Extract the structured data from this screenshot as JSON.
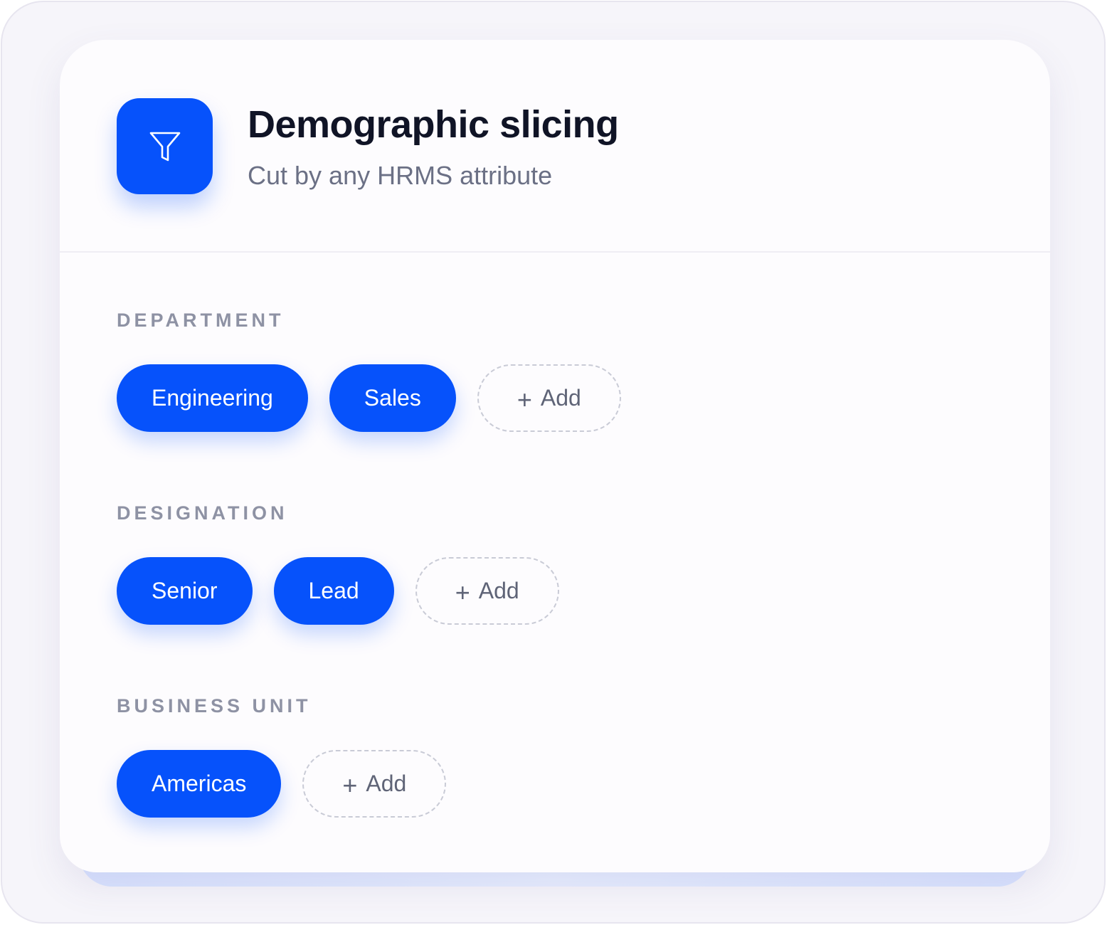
{
  "header": {
    "icon": "filter-funnel-icon",
    "title": "Demographic slicing",
    "subtitle": "Cut by any HRMS attribute"
  },
  "colors": {
    "accent": "#0652fb",
    "label_gray": "#8e92a4",
    "title_text": "#101426"
  },
  "sections": [
    {
      "label": "DEPARTMENT",
      "chips": [
        "Engineering",
        "Sales"
      ],
      "add_label": "Add"
    },
    {
      "label": "DESIGNATION",
      "chips": [
        "Senior",
        "Lead"
      ],
      "add_label": "Add"
    },
    {
      "label": "BUSINESS UNIT",
      "chips": [
        "Americas"
      ],
      "add_label": "Add"
    }
  ]
}
